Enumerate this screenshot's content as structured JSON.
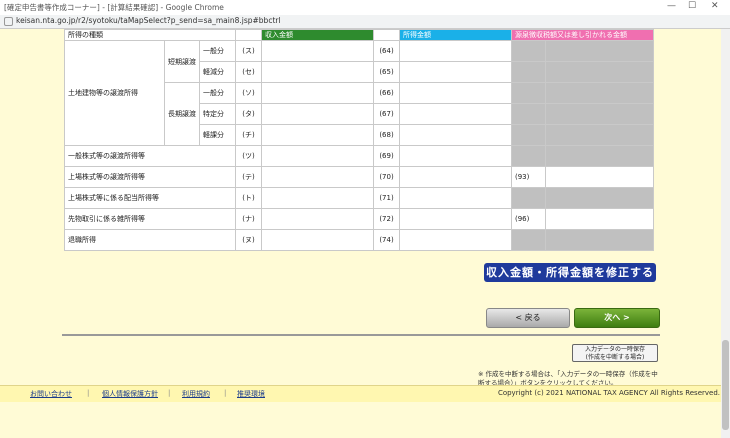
{
  "window": {
    "title": "[確定申告書等作成コーナー] - [計算結果確認] - Google Chrome",
    "minimize": "—",
    "maximize": "☐",
    "close": "✕"
  },
  "address_bar": {
    "url": "keisan.nta.go.jp/r2/syotoku/taMapSelect?p_send=sa_main8.jsp#bbctrl"
  },
  "table": {
    "headers": [
      "所得の種類",
      "収入金額",
      "所得金額",
      "源泉徴収税額又は差し引かれる金額"
    ],
    "land_group": "土地建物等の譲渡所得",
    "short_term": "短期譲渡",
    "long_term": "長期譲渡",
    "rows": [
      {
        "sub": "一般分",
        "code": "(ス)",
        "num": "(64)",
        "wh": ""
      },
      {
        "sub": "軽減分",
        "code": "(セ)",
        "num": "(65)",
        "wh": ""
      },
      {
        "sub": "一般分",
        "code": "(ソ)",
        "num": "(66)",
        "wh": ""
      },
      {
        "sub": "特定分",
        "code": "(タ)",
        "num": "(67)",
        "wh": ""
      },
      {
        "sub": "軽課分",
        "code": "(チ)",
        "num": "(68)",
        "wh": ""
      },
      {
        "label": "一般株式等の譲渡所得等",
        "code": "(ツ)",
        "num": "(69)",
        "wh": ""
      },
      {
        "label": "上場株式等の譲渡所得等",
        "code": "(テ)",
        "num": "(70)",
        "wh": "(93)"
      },
      {
        "label": "上場株式等に係る配当所得等",
        "code": "(ト)",
        "num": "(71)",
        "wh": ""
      },
      {
        "label": "先物取引に係る雑所得等",
        "code": "(ナ)",
        "num": "(72)",
        "wh": "(96)"
      },
      {
        "label": "退職所得",
        "code": "(ヌ)",
        "num": "(74)",
        "wh": ""
      }
    ]
  },
  "buttons": {
    "fix": "収入金額・所得金額を修正する",
    "back": "< 戻る",
    "next": "次へ >",
    "save_line1": "入力データの一時保存",
    "save_line2": "(作成を中断する場合)"
  },
  "note": "※ 作成を中断する場合は、「入力データの一時保存（作成を中断する場合）」ボタンをクリックしてください。",
  "footer": {
    "links": [
      "お問い合わせ",
      "個人情報保護方針",
      "利用規約",
      "推奨環境"
    ],
    "copyright": "Copyright (c) 2021 NATIONAL TAX AGENCY All Rights Reserved."
  },
  "colors": {
    "header_income": "#2e8b2e",
    "header_amount": "#1ab0e8",
    "header_withholding": "#f06fb0",
    "fix_button": "#1f3a9c",
    "next_button": "#4a8a18"
  }
}
